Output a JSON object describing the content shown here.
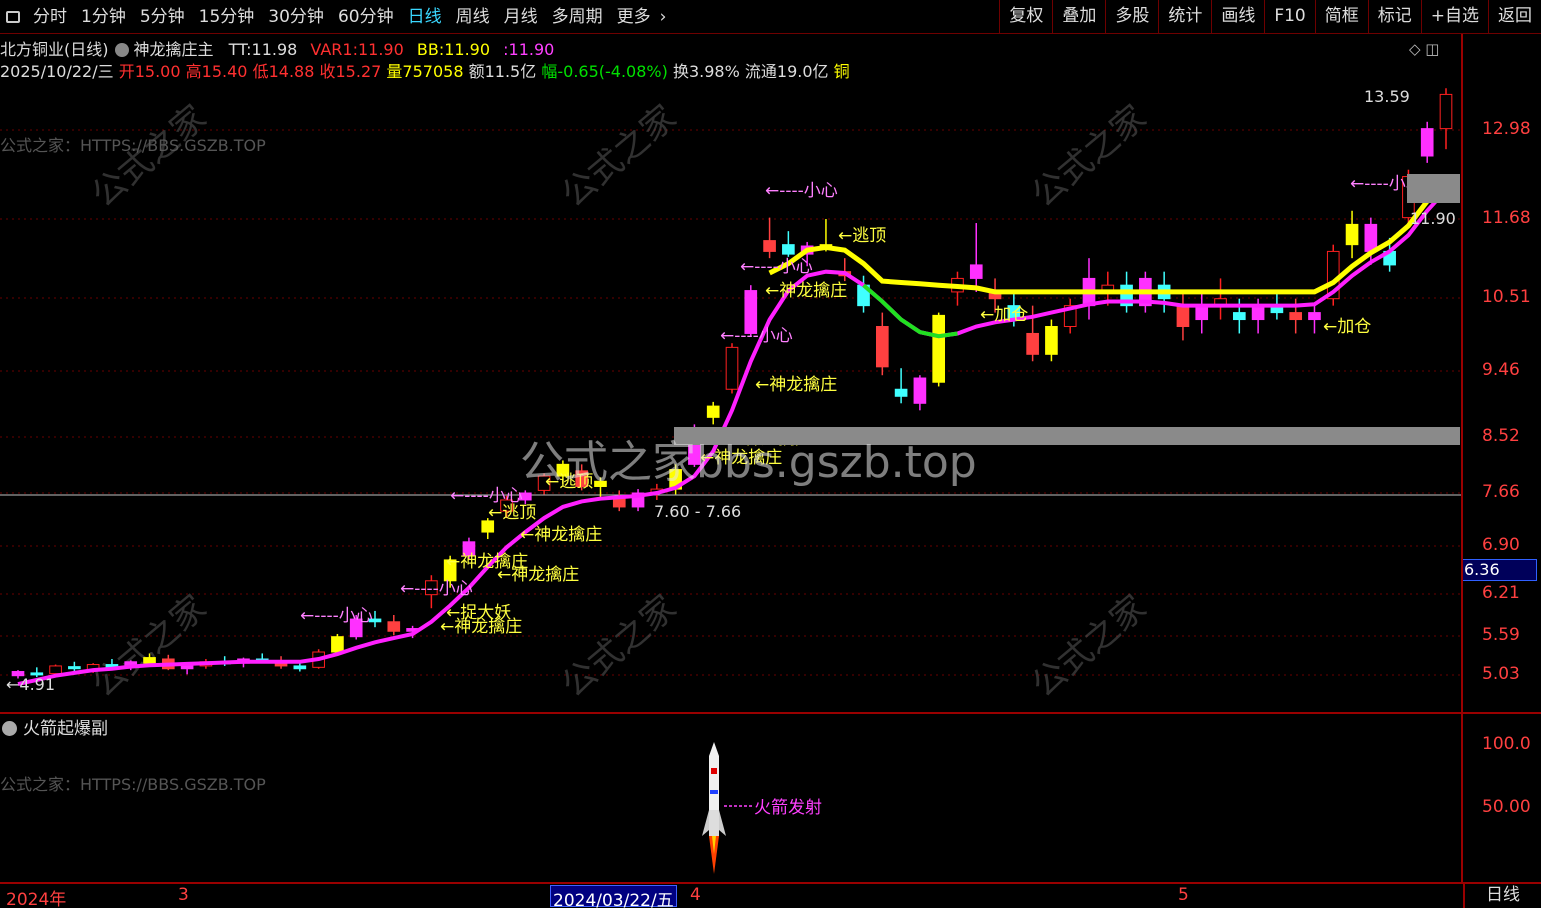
{
  "toolbar": {
    "periods": [
      "分时",
      "1分钟",
      "5分钟",
      "15分钟",
      "30分钟",
      "60分钟",
      "日线",
      "周线",
      "月线",
      "多周期",
      "更多"
    ],
    "active_period": "日线",
    "buttons": [
      "复权",
      "叠加",
      "多股",
      "统计",
      "画线",
      "F10",
      "简框",
      "标记",
      "+自选",
      "返回"
    ]
  },
  "stock": {
    "name": "北方铜业(日线)",
    "indicator_main": "神龙擒庄主",
    "tt_label": "TT:",
    "tt_value": "11.98",
    "var1_label": "VAR1:",
    "var1_value": "11.90",
    "bb_label": "BB:",
    "bb_value": "11.90",
    "extra_label": ":",
    "extra_value": "11.90"
  },
  "quote": {
    "date": "2025/10/22/三",
    "open_label": "开",
    "open": "15.00",
    "high_label": "高",
    "high": "15.40",
    "low_label": "低",
    "low": "14.88",
    "close_label": "收",
    "close": "15.27",
    "vol_label": "量",
    "vol": "757058",
    "amount_label": "额",
    "amount": "11.5亿",
    "change_label": "幅",
    "change": "-0.65(-4.08%)",
    "turnover_label": "换",
    "turnover": "3.98%",
    "float_label": "流通",
    "float": "19.0亿",
    "sector": "铜"
  },
  "source_text": "公式之家：HTTPS://BBS.GSZB.TOP",
  "watermark": "公式之家bbs.gszb.top",
  "price_axis": [
    {
      "v": 12.98,
      "label": "12.98"
    },
    {
      "v": 11.68,
      "label": "11.68"
    },
    {
      "v": 10.51,
      "label": "10.51"
    },
    {
      "v": 9.46,
      "label": "9.46"
    },
    {
      "v": 8.52,
      "label": "8.52"
    },
    {
      "v": 7.66,
      "label": "7.66"
    },
    {
      "v": 6.9,
      "label": "6.90"
    },
    {
      "v": 6.21,
      "label": "6.21"
    },
    {
      "v": 5.59,
      "label": "5.59"
    },
    {
      "v": 5.03,
      "label": "5.03"
    }
  ],
  "current_price": "6.36",
  "high_mark": "13.59",
  "low_mark": "4.91",
  "right_price_mark": "11.90",
  "range_label": "7.60 - 7.66",
  "sub_indicator": "火箭起爆副",
  "sub_axis": [
    "100.0",
    "50.00"
  ],
  "rocket_label": "火箭发射",
  "dates": {
    "year": "2024年",
    "m3": "3",
    "cursor": "2024/03/22/五",
    "m4": "4",
    "m5": "5"
  },
  "period_label": "日线",
  "chart_data": {
    "type": "candlestick",
    "ylim": [
      4.6,
      14.0
    ],
    "candles": [
      [
        5.02,
        5.1,
        4.98,
        5.08
      ],
      [
        5.06,
        5.14,
        5.0,
        5.04
      ],
      [
        5.05,
        5.18,
        5.02,
        5.16
      ],
      [
        5.15,
        5.22,
        5.08,
        5.12
      ],
      [
        5.1,
        5.2,
        5.06,
        5.18
      ],
      [
        5.18,
        5.26,
        5.12,
        5.14
      ],
      [
        5.14,
        5.24,
        5.1,
        5.22
      ],
      [
        5.2,
        5.34,
        5.16,
        5.28
      ],
      [
        5.26,
        5.32,
        5.1,
        5.12
      ],
      [
        5.12,
        5.2,
        5.04,
        5.16
      ],
      [
        5.16,
        5.26,
        5.12,
        5.22
      ],
      [
        5.22,
        5.3,
        5.16,
        5.2
      ],
      [
        5.2,
        5.28,
        5.14,
        5.26
      ],
      [
        5.26,
        5.34,
        5.2,
        5.22
      ],
      [
        5.22,
        5.3,
        5.12,
        5.16
      ],
      [
        5.16,
        5.22,
        5.08,
        5.12
      ],
      [
        5.14,
        5.4,
        5.12,
        5.36
      ],
      [
        5.36,
        5.62,
        5.32,
        5.58
      ],
      [
        5.58,
        5.9,
        5.54,
        5.84
      ],
      [
        5.84,
        5.96,
        5.72,
        5.8
      ],
      [
        5.8,
        5.9,
        5.6,
        5.66
      ],
      [
        5.66,
        5.74,
        5.56,
        5.7
      ],
      [
        6.2,
        6.48,
        6.0,
        6.4
      ],
      [
        6.4,
        6.76,
        6.3,
        6.7
      ],
      [
        6.76,
        7.02,
        6.7,
        6.96
      ],
      [
        7.1,
        7.3,
        7.0,
        7.26
      ],
      [
        7.4,
        7.62,
        7.3,
        7.56
      ],
      [
        7.56,
        7.7,
        7.5,
        7.66
      ],
      [
        7.7,
        7.96,
        7.64,
        7.92
      ],
      [
        7.92,
        8.16,
        7.8,
        8.1
      ],
      [
        8.0,
        8.1,
        7.7,
        7.76
      ],
      [
        7.76,
        7.9,
        7.6,
        7.84
      ],
      [
        7.6,
        7.7,
        7.4,
        7.46
      ],
      [
        7.46,
        7.72,
        7.4,
        7.66
      ],
      [
        7.66,
        7.8,
        7.56,
        7.72
      ],
      [
        7.72,
        8.1,
        7.64,
        8.02
      ],
      [
        8.1,
        8.7,
        8.06,
        8.62
      ],
      [
        8.8,
        9.02,
        8.7,
        8.96
      ],
      [
        9.2,
        9.86,
        9.14,
        9.8
      ],
      [
        10.0,
        10.7,
        9.96,
        10.62
      ],
      [
        11.36,
        11.7,
        11.1,
        11.2
      ],
      [
        11.3,
        11.5,
        11.12,
        11.16
      ],
      [
        11.16,
        11.34,
        10.98,
        11.28
      ],
      [
        11.28,
        11.68,
        11.2,
        11.3
      ],
      [
        10.9,
        11.1,
        10.76,
        10.84
      ],
      [
        10.7,
        10.84,
        10.3,
        10.4
      ],
      [
        10.1,
        10.3,
        9.4,
        9.52
      ],
      [
        9.2,
        9.5,
        9.0,
        9.1
      ],
      [
        9.0,
        9.4,
        8.9,
        9.36
      ],
      [
        9.3,
        10.3,
        9.24,
        10.26
      ],
      [
        10.6,
        10.9,
        10.4,
        10.8
      ],
      [
        10.8,
        11.62,
        10.6,
        11.0
      ],
      [
        10.6,
        10.8,
        10.3,
        10.5
      ],
      [
        10.4,
        10.6,
        10.1,
        10.2
      ],
      [
        10.0,
        10.4,
        9.6,
        9.7
      ],
      [
        9.7,
        10.2,
        9.6,
        10.1
      ],
      [
        10.1,
        10.5,
        10.0,
        10.4
      ],
      [
        10.4,
        11.1,
        10.2,
        10.8
      ],
      [
        10.6,
        10.9,
        10.4,
        10.7
      ],
      [
        10.7,
        10.9,
        10.3,
        10.4
      ],
      [
        10.4,
        10.9,
        10.3,
        10.8
      ],
      [
        10.7,
        10.9,
        10.3,
        10.5
      ],
      [
        10.4,
        10.6,
        9.9,
        10.1
      ],
      [
        10.2,
        10.6,
        10.0,
        10.4
      ],
      [
        10.4,
        10.8,
        10.2,
        10.5
      ],
      [
        10.3,
        10.5,
        10.0,
        10.2
      ],
      [
        10.2,
        10.5,
        10.0,
        10.4
      ],
      [
        10.4,
        10.6,
        10.2,
        10.3
      ],
      [
        10.3,
        10.5,
        10.0,
        10.2
      ],
      [
        10.2,
        10.4,
        10.0,
        10.3
      ],
      [
        10.5,
        11.3,
        10.4,
        11.2
      ],
      [
        11.3,
        11.8,
        11.1,
        11.6
      ],
      [
        11.2,
        11.7,
        11.0,
        11.6
      ],
      [
        11.2,
        11.4,
        10.9,
        11.0
      ],
      [
        11.7,
        12.4,
        11.6,
        12.3
      ],
      [
        12.6,
        13.1,
        12.5,
        13.0
      ],
      [
        13.0,
        13.59,
        12.7,
        13.5
      ]
    ],
    "ma_points": [
      4.9,
      4.96,
      5.02,
      5.06,
      5.1,
      5.12,
      5.15,
      5.17,
      5.18,
      5.19,
      5.2,
      5.21,
      5.22,
      5.22,
      5.22,
      5.22,
      5.26,
      5.33,
      5.42,
      5.5,
      5.56,
      5.62,
      5.8,
      6.04,
      6.3,
      6.6,
      6.88,
      7.1,
      7.3,
      7.46,
      7.54,
      7.58,
      7.6,
      7.62,
      7.66,
      7.74,
      7.92,
      8.3,
      8.9,
      9.6,
      10.2,
      10.62,
      10.84,
      10.9,
      10.88,
      10.7,
      10.46,
      10.2,
      10.02,
      9.96,
      10.0,
      10.1,
      10.16,
      10.2,
      10.24,
      10.3,
      10.36,
      10.42,
      10.46,
      10.46,
      10.46,
      10.44,
      10.4,
      10.4,
      10.4,
      10.4,
      10.4,
      10.4,
      10.4,
      10.42,
      10.6,
      10.84,
      11.04,
      11.2,
      11.44,
      11.8,
      12.1
    ],
    "annotations_yellow": [
      "神龙擒庄",
      "逃顶",
      "捉大妖",
      "加仓"
    ],
    "annotations_white": [
      "小心"
    ]
  }
}
